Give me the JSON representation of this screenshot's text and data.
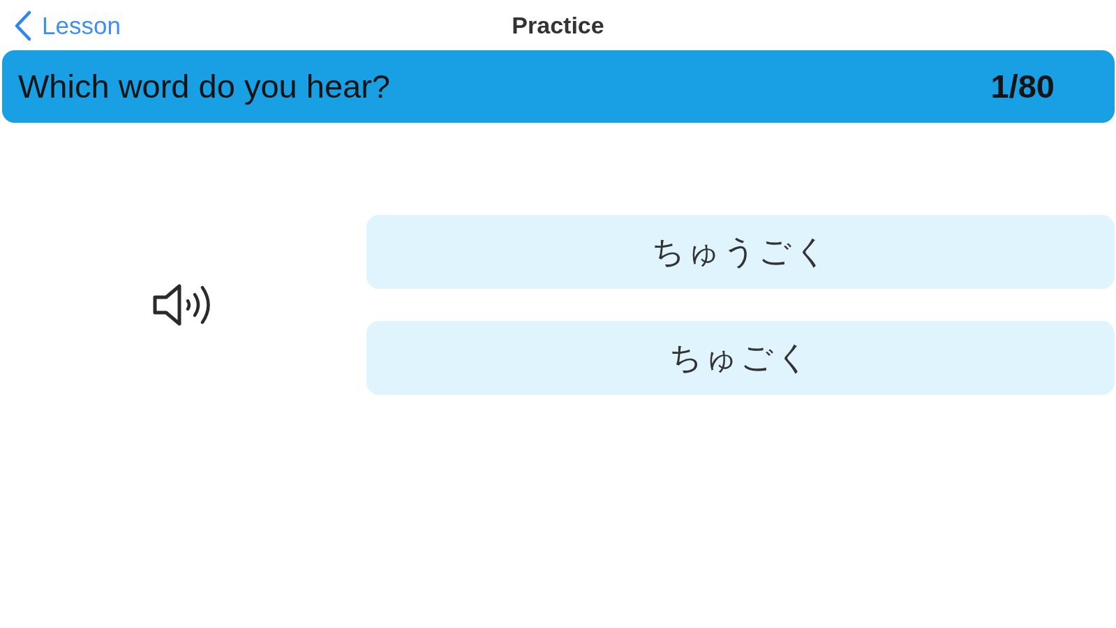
{
  "nav_bar": {
    "back_button": {
      "label": "Lesson"
    },
    "title": "Practice"
  },
  "prompt_bar": {
    "question": "Which word do you hear?",
    "progress": "1/80"
  },
  "answers": [
    {
      "label": "ちゅうごく"
    },
    {
      "label": "ちゅごく"
    }
  ]
}
